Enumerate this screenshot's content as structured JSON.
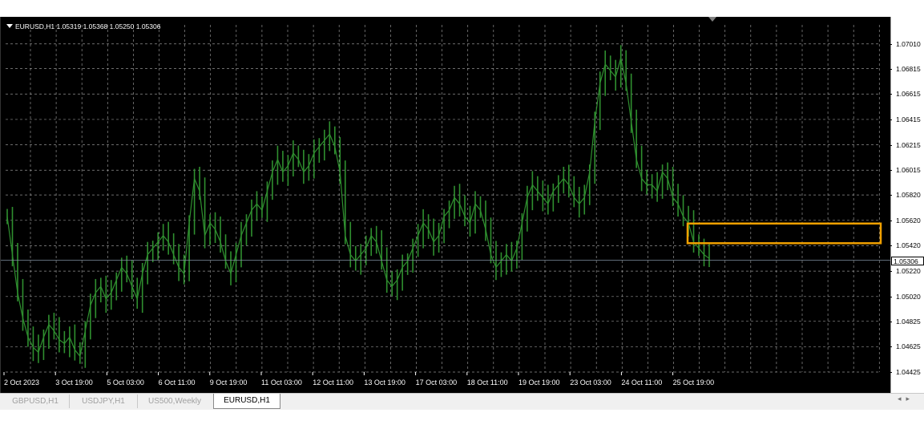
{
  "window": {
    "symbol": "EURUSD",
    "timeframe": "H1",
    "header_text": "EURUSD,H1  1.05319 1.05368 1.05250 1.05306"
  },
  "colors": {
    "background": "#000000",
    "candles": "#2f8f2f",
    "grid": "#c0c0c0",
    "highlight_box": "#f0a000",
    "price_line": "#8090a0"
  },
  "chart_data": {
    "type": "ohlc",
    "symbol": "EURUSD,H1",
    "open": 1.05319,
    "high": 1.05368,
    "low": 1.0525,
    "close": 1.05306,
    "current_price": 1.05306,
    "ylim": [
      1.04425,
      1.0716
    ],
    "y_ticks": [
      "1.07010",
      "1.06815",
      "1.06615",
      "1.06415",
      "1.06215",
      "1.06015",
      "1.05820",
      "1.05620",
      "1.05420",
      "1.05220",
      "1.05020",
      "1.04825",
      "1.04625",
      "1.04425"
    ],
    "x_ticks": [
      "2 Oct 2023",
      "3 Oct 19:00",
      "5 Oct 03:00",
      "6 Oct 11:00",
      "9 Oct 19:00",
      "11 Oct 03:00",
      "12 Oct 11:00",
      "13 Oct 19:00",
      "17 Oct 03:00",
      "18 Oct 11:00",
      "19 Oct 19:00",
      "23 Oct 03:00",
      "24 Oct 11:00",
      "25 Oct 19:00"
    ],
    "series": [
      {
        "values": [
          1.0565,
          1.0535,
          1.0505,
          1.0485,
          1.047,
          1.0462,
          1.0458,
          1.047,
          1.048,
          1.0475,
          1.0468,
          1.0465,
          1.047,
          1.046,
          1.0455,
          1.0475,
          1.0495,
          1.0505,
          1.051,
          1.05,
          1.0505,
          1.0515,
          1.0525,
          1.052,
          1.051,
          1.05,
          1.052,
          1.0535,
          1.054,
          1.0545,
          1.055,
          1.0545,
          1.0535,
          1.0525,
          1.052,
          1.056,
          1.0595,
          1.0585,
          1.055,
          1.056,
          1.0555,
          1.0545,
          1.053,
          1.052,
          1.0535,
          1.055,
          1.056,
          1.057,
          1.0575,
          1.057,
          1.0585,
          1.06,
          1.061,
          1.06,
          1.0605,
          1.0615,
          1.061,
          1.06,
          1.0605,
          1.0615,
          1.062,
          1.0625,
          1.063,
          1.062,
          1.06,
          1.055,
          1.0535,
          1.053,
          1.0535,
          1.054,
          1.055,
          1.0545,
          1.053,
          1.0515,
          1.051,
          1.0515,
          1.0525,
          1.053,
          1.054,
          1.055,
          1.056,
          1.0555,
          1.0545,
          1.055,
          1.0565,
          1.057,
          1.058,
          1.0575,
          1.0565,
          1.056,
          1.0575,
          1.057,
          1.0555,
          1.0535,
          1.0525,
          1.053,
          1.0535,
          1.053,
          1.054,
          1.056,
          1.058,
          1.059,
          1.0585,
          1.058,
          1.0575,
          1.0585,
          1.059,
          1.0595,
          1.059,
          1.058,
          1.0575,
          1.058,
          1.06,
          1.064,
          1.067,
          1.0685,
          1.068,
          1.0675,
          1.069,
          1.067,
          1.064,
          1.061,
          1.0595,
          1.059,
          1.059,
          1.0585,
          1.06,
          1.0595,
          1.058,
          1.0575,
          1.0565,
          1.056,
          1.0545,
          1.054,
          1.0535,
          1.0532
        ]
      }
    ],
    "highlight_box": {
      "price_high": 1.05595,
      "price_low": 1.0544
    }
  },
  "tabs": [
    {
      "label": "GBPUSD,H1",
      "active": false
    },
    {
      "label": "USDJPY,H1",
      "active": false
    },
    {
      "label": "US500,Weekly",
      "active": false
    },
    {
      "label": "EURUSD,H1",
      "active": true
    }
  ],
  "tab_scroll": {
    "left": "◂",
    "right": "▸"
  }
}
